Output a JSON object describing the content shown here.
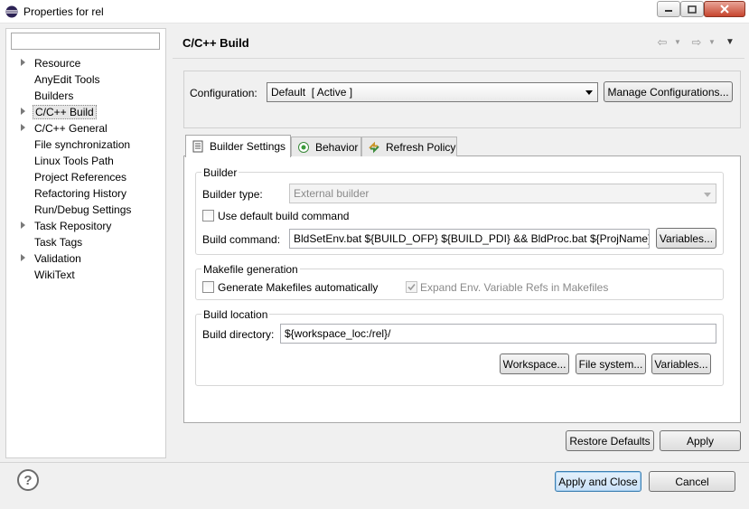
{
  "window": {
    "title": "Properties for rel"
  },
  "sidebar": {
    "filter_placeholder": "",
    "items": [
      {
        "label": "Resource",
        "expandable": true,
        "selected": false
      },
      {
        "label": "AnyEdit Tools",
        "expandable": false,
        "selected": false
      },
      {
        "label": "Builders",
        "expandable": false,
        "selected": false
      },
      {
        "label": "C/C++ Build",
        "expandable": true,
        "selected": true
      },
      {
        "label": "C/C++ General",
        "expandable": true,
        "selected": false
      },
      {
        "label": "File synchronization",
        "expandable": false,
        "selected": false
      },
      {
        "label": "Linux Tools Path",
        "expandable": false,
        "selected": false
      },
      {
        "label": "Project References",
        "expandable": false,
        "selected": false
      },
      {
        "label": "Refactoring History",
        "expandable": false,
        "selected": false
      },
      {
        "label": "Run/Debug Settings",
        "expandable": false,
        "selected": false
      },
      {
        "label": "Task Repository",
        "expandable": true,
        "selected": false
      },
      {
        "label": "Task Tags",
        "expandable": false,
        "selected": false
      },
      {
        "label": "Validation",
        "expandable": true,
        "selected": false
      },
      {
        "label": "WikiText",
        "expandable": false,
        "selected": false
      }
    ]
  },
  "header": {
    "title": "C/C++ Build"
  },
  "configuration": {
    "label": "Configuration:",
    "value": "Default  [ Active ]",
    "manage_label": "Manage Configurations..."
  },
  "tabs": [
    {
      "label": "Builder Settings",
      "active": true,
      "icon": "document-icon"
    },
    {
      "label": "Behavior",
      "active": false,
      "icon": "radio-icon"
    },
    {
      "label": "Refresh Policy",
      "active": false,
      "icon": "refresh-icon"
    }
  ],
  "builder": {
    "title": "Builder",
    "type_label": "Builder type:",
    "type_value": "External builder",
    "use_default_label": "Use default build command",
    "use_default_checked": false,
    "command_label": "Build command:",
    "command_value": "BldSetEnv.bat ${BUILD_OFP} ${BUILD_PDI} && BldProc.bat ${ProjName} ${",
    "variables_label": "Variables..."
  },
  "makefile": {
    "title": "Makefile generation",
    "generate_label": "Generate Makefiles automatically",
    "generate_checked": false,
    "expand_label": "Expand Env. Variable Refs in Makefiles",
    "expand_checked": true
  },
  "location": {
    "title": "Build location",
    "dir_label": "Build directory:",
    "dir_value": "${workspace_loc:/rel}/",
    "workspace_label": "Workspace...",
    "filesystem_label": "File system...",
    "variables_label": "Variables..."
  },
  "actions": {
    "restore_label": "Restore Defaults",
    "apply_label": "Apply",
    "apply_close_label": "Apply and Close",
    "cancel_label": "Cancel"
  },
  "colors": {
    "accent": "#3c7fb1",
    "panel_bg": "#f0f0f0"
  }
}
